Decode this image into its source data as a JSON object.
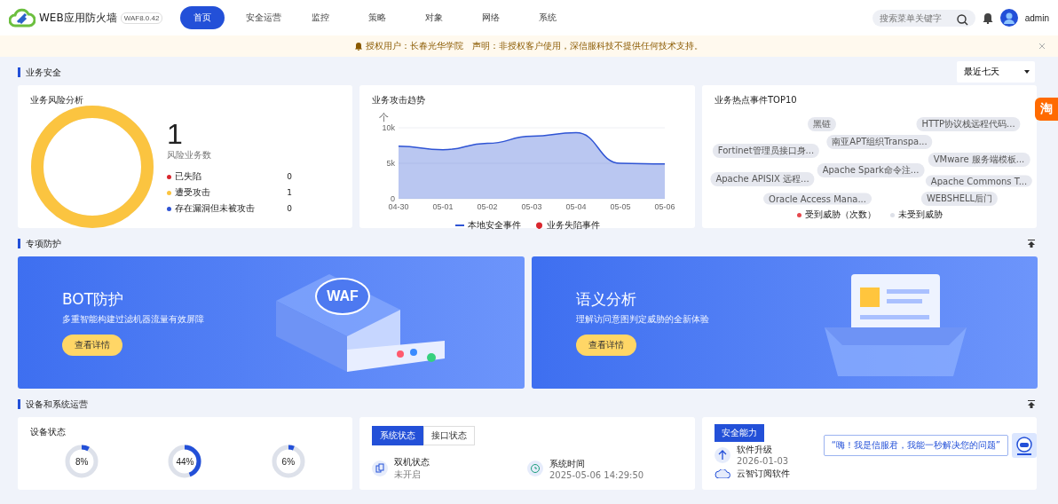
{
  "header": {
    "product": "WEB应用防火墙",
    "version": "WAF8.0.42",
    "nav": [
      {
        "label": "首页",
        "selected": true
      },
      {
        "label": "安全运营",
        "selected": false
      },
      {
        "label": "监控",
        "selected": false
      },
      {
        "label": "策略",
        "selected": false
      },
      {
        "label": "对象",
        "selected": false
      },
      {
        "label": "网络",
        "selected": false
      },
      {
        "label": "系统",
        "selected": false
      }
    ],
    "search": {
      "placeholder": "搜索菜单关键字"
    },
    "user": "admin"
  },
  "notice": "授权用户：长春光华学院　声明：非授权客户使用，深信服科技不提供任何技术支持。",
  "business_security": {
    "title": "业务安全",
    "range": "最近七天",
    "risk": {
      "title": "业务风险分析",
      "count": "1",
      "count_label": "风险业务数",
      "items": [
        {
          "label": "已失陷",
          "value": "0",
          "color": "#d9272e"
        },
        {
          "label": "遭受攻击",
          "value": "1",
          "color": "#fbc440"
        },
        {
          "label": "存在漏洞但未被攻击",
          "value": "0",
          "color": "#2f54d4"
        }
      ]
    },
    "trend": {
      "title": "业务攻击趋势",
      "unit": "个",
      "chart_data": {
        "type": "area",
        "categories": [
          "04-30",
          "05-01",
          "05-02",
          "05-03",
          "05-04",
          "05-05",
          "05-06"
        ],
        "yticks": [
          0,
          {
            "value": 5000,
            "label": "5k"
          },
          {
            "value": 10000,
            "label": "10k"
          }
        ],
        "ylim": [
          0,
          10000
        ],
        "series": [
          {
            "name": "本地安全事件",
            "color": "#2f54d4",
            "values": [
              7400,
              6900,
              7800,
              8800,
              9300,
              5000,
              4900
            ]
          },
          {
            "name": "业务失陷事件",
            "color": "#d9272e",
            "values": [
              null,
              null,
              null,
              null,
              null,
              null,
              null
            ]
          }
        ]
      }
    },
    "hot": {
      "title": "业务热点事件TOP10",
      "tags": [
        {
          "label": "黑链",
          "threatened": false
        },
        {
          "label": "HTTP协议栈远程代码...",
          "threatened": false
        },
        {
          "label": "南亚APT组织Transpa...",
          "threatened": false
        },
        {
          "label": "Fortinet管理员接口身...",
          "threatened": false
        },
        {
          "label": "VMware 服务端模板...",
          "threatened": false
        },
        {
          "label": "Apache Spark命令注...",
          "threatened": false
        },
        {
          "label": "Apache APISIX 远程...",
          "threatened": false
        },
        {
          "label": "Apache Commons T...",
          "threatened": false
        },
        {
          "label": "Oracle Access Mana...",
          "threatened": false
        },
        {
          "label": "WEBSHELL后门",
          "threatened": false
        }
      ],
      "legend": [
        {
          "label": "受到威胁（次数）",
          "threatened": true
        },
        {
          "label": "未受到威胁",
          "threatened": false
        }
      ]
    }
  },
  "special": {
    "title": "专项防护",
    "banners": [
      {
        "kind": "bot",
        "title": "BOT防护",
        "subtitle": "多重智能构建过滤机器流量有效屏障",
        "button": "查看详情",
        "art_label": "WAF"
      },
      {
        "kind": "semantic",
        "title": "语义分析",
        "subtitle": "理解访问意图判定威胁的全新体验",
        "button": "查看详情"
      }
    ]
  },
  "ops": {
    "title": "设备和系统运营",
    "device": {
      "title": "设备状态",
      "gauges": [
        {
          "level": 0.08,
          "text": "8%"
        },
        {
          "level": 0.44,
          "text": "44%"
        },
        {
          "level": 0.06,
          "text": "6%"
        }
      ]
    },
    "system": {
      "tabs": [
        {
          "label": "系统状态",
          "selected": true
        },
        {
          "label": "接口状态",
          "selected": false
        }
      ],
      "items": [
        {
          "kind": "ha",
          "label": "双机状态",
          "value": "未开启"
        },
        {
          "kind": "clock",
          "label": "系统时间",
          "value": "2025-05-06 14:29:50"
        }
      ]
    },
    "capability": {
      "badge": "安全能力",
      "items": [
        {
          "kind": "upgrade",
          "label": "软件升级",
          "value": "2026-01-03"
        },
        {
          "kind": "cloud",
          "label": "云智订阅软件"
        }
      ]
    },
    "chat": "“嗨！我是信服君，我能一秒解决您的问题”"
  },
  "float_button": "淘"
}
